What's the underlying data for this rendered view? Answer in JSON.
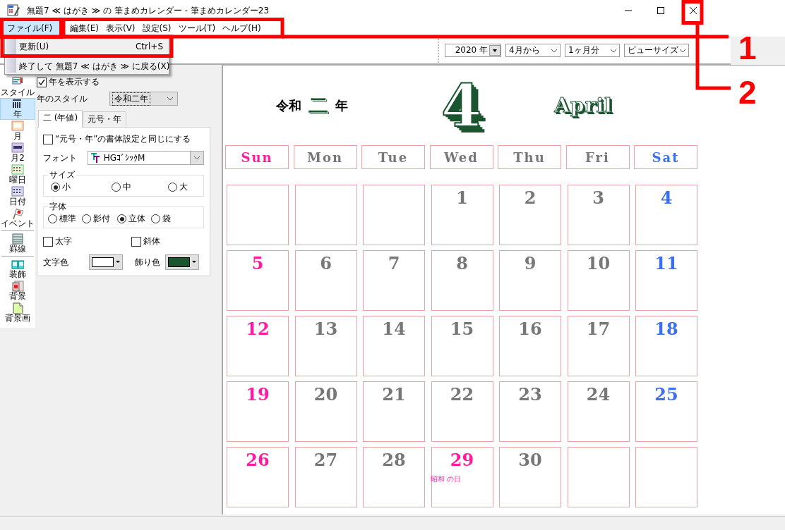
{
  "window": {
    "title": "無題7 ≪ はがき ≫ の 筆まめカレンダー - 筆まめカレンダー23"
  },
  "menu_bar": [
    {
      "label": "ファイル(F)",
      "selected": true
    },
    {
      "label": "編集(E)",
      "selected": false
    },
    {
      "label": "表示(V)",
      "selected": false
    },
    {
      "label": "設定(S)",
      "selected": false
    },
    {
      "label": "ツール(T)",
      "selected": false
    },
    {
      "label": "ヘルプ(H)",
      "selected": false
    }
  ],
  "file_menu": [
    {
      "kind": "item",
      "label": "更新(U)",
      "shortcut": "Ctrl+S"
    },
    {
      "kind": "separator"
    },
    {
      "kind": "item",
      "label": "終了して 無題7 ≪ はがき ≫ に戻る(X)"
    }
  ],
  "toolbar": [
    {
      "kind": "spin",
      "value": "2020 年"
    },
    {
      "kind": "combo",
      "value": "4月から"
    },
    {
      "kind": "combo",
      "value": "1ヶ月分"
    },
    {
      "kind": "combo",
      "value": "ビューサイズ"
    }
  ],
  "sidebar": {
    "items": [
      {
        "label": "スタイル",
        "selected": false
      },
      {
        "label": "年",
        "selected": true
      },
      {
        "label": "月",
        "selected": false
      },
      {
        "label": "月2",
        "selected": false
      },
      {
        "label": "曜日",
        "selected": false
      },
      {
        "label": "日付",
        "selected": false
      },
      {
        "label": "イベント",
        "selected": false
      },
      {
        "label": "罫線",
        "selected": false
      },
      {
        "label": "装飾",
        "selected": false
      },
      {
        "label": "背景",
        "selected": false
      },
      {
        "label": "背景画",
        "selected": false
      }
    ]
  },
  "panel": {
    "show_year": {
      "label": "年を表示する",
      "checked": true
    },
    "year_style": {
      "label": "年のスタイル",
      "value": "令和二年"
    },
    "tabs": [
      {
        "label": "二 (年値)",
        "selected": true
      },
      {
        "label": "元号・年",
        "selected": false
      }
    ],
    "same_font": {
      "label": "“元号・年”の書体設定と同じにする",
      "checked": false
    },
    "font": {
      "label": "フォント",
      "value": "HGｺﾞｼｯｸM"
    },
    "size": {
      "label": "サイズ",
      "options": [
        {
          "label": "小",
          "selected": true
        },
        {
          "label": "中",
          "selected": false
        },
        {
          "label": "大",
          "selected": false
        }
      ]
    },
    "style": {
      "label": "字体",
      "options": [
        {
          "label": "標準",
          "selected": false
        },
        {
          "label": "影付",
          "selected": false
        },
        {
          "label": "立体",
          "selected": true
        },
        {
          "label": "袋",
          "selected": false
        }
      ]
    },
    "bold": {
      "label": "太字",
      "checked": false
    },
    "italic": {
      "label": "斜体",
      "checked": false
    },
    "text_color": {
      "label": "文字色",
      "color": "#ffffff"
    },
    "deco_color": {
      "label": "飾り色",
      "color": "#1a5530"
    }
  },
  "calendar": {
    "era": "令和",
    "year": "二",
    "year_suffix": "年",
    "month": "4",
    "month_name": "April",
    "weekdays": [
      {
        "label": "Sun",
        "color": "#ff1aa0"
      },
      {
        "label": "Mon",
        "color": "#777777"
      },
      {
        "label": "Tue",
        "color": "#777777"
      },
      {
        "label": "Wed",
        "color": "#777777"
      },
      {
        "label": "Thu",
        "color": "#777777"
      },
      {
        "label": "Fri",
        "color": "#777777"
      },
      {
        "label": "Sat",
        "color": "#3a6ff0"
      }
    ],
    "weeks": [
      [
        {
          "kind": "blank"
        },
        {
          "kind": "blank"
        },
        {
          "kind": "blank"
        },
        {
          "kind": "day",
          "day": "1",
          "color": "#777777"
        },
        {
          "kind": "day",
          "day": "2",
          "color": "#777777"
        },
        {
          "kind": "day",
          "day": "3",
          "color": "#777777"
        },
        {
          "kind": "day",
          "day": "4",
          "color": "#3a6ff0"
        }
      ],
      [
        {
          "kind": "day",
          "day": "5",
          "color": "#ff1aa0"
        },
        {
          "kind": "day",
          "day": "6",
          "color": "#777777"
        },
        {
          "kind": "day",
          "day": "7",
          "color": "#777777"
        },
        {
          "kind": "day",
          "day": "8",
          "color": "#777777"
        },
        {
          "kind": "day",
          "day": "9",
          "color": "#777777"
        },
        {
          "kind": "day",
          "day": "10",
          "color": "#777777"
        },
        {
          "kind": "day",
          "day": "11",
          "color": "#3a6ff0"
        }
      ],
      [
        {
          "kind": "day",
          "day": "12",
          "color": "#ff1aa0"
        },
        {
          "kind": "day",
          "day": "13",
          "color": "#777777"
        },
        {
          "kind": "day",
          "day": "14",
          "color": "#777777"
        },
        {
          "kind": "day",
          "day": "15",
          "color": "#777777"
        },
        {
          "kind": "day",
          "day": "16",
          "color": "#777777"
        },
        {
          "kind": "day",
          "day": "17",
          "color": "#777777"
        },
        {
          "kind": "day",
          "day": "18",
          "color": "#3a6ff0"
        }
      ],
      [
        {
          "kind": "day",
          "day": "19",
          "color": "#ff1aa0"
        },
        {
          "kind": "day",
          "day": "20",
          "color": "#777777"
        },
        {
          "kind": "day",
          "day": "21",
          "color": "#777777"
        },
        {
          "kind": "day",
          "day": "22",
          "color": "#777777"
        },
        {
          "kind": "day",
          "day": "23",
          "color": "#777777"
        },
        {
          "kind": "day",
          "day": "24",
          "color": "#777777"
        },
        {
          "kind": "day",
          "day": "25",
          "color": "#3a6ff0"
        }
      ],
      [
        {
          "kind": "day",
          "day": "26",
          "color": "#ff1aa0"
        },
        {
          "kind": "day",
          "day": "27",
          "color": "#777777"
        },
        {
          "kind": "day",
          "day": "28",
          "color": "#777777"
        },
        {
          "kind": "day",
          "day": "29",
          "color": "#ff1aa0",
          "holiday": "昭和 の日"
        },
        {
          "kind": "day",
          "day": "30",
          "color": "#777777"
        },
        {
          "kind": "blank"
        },
        {
          "kind": "blank"
        }
      ]
    ]
  },
  "annotations": [
    {
      "label": "1"
    },
    {
      "label": "2"
    }
  ]
}
